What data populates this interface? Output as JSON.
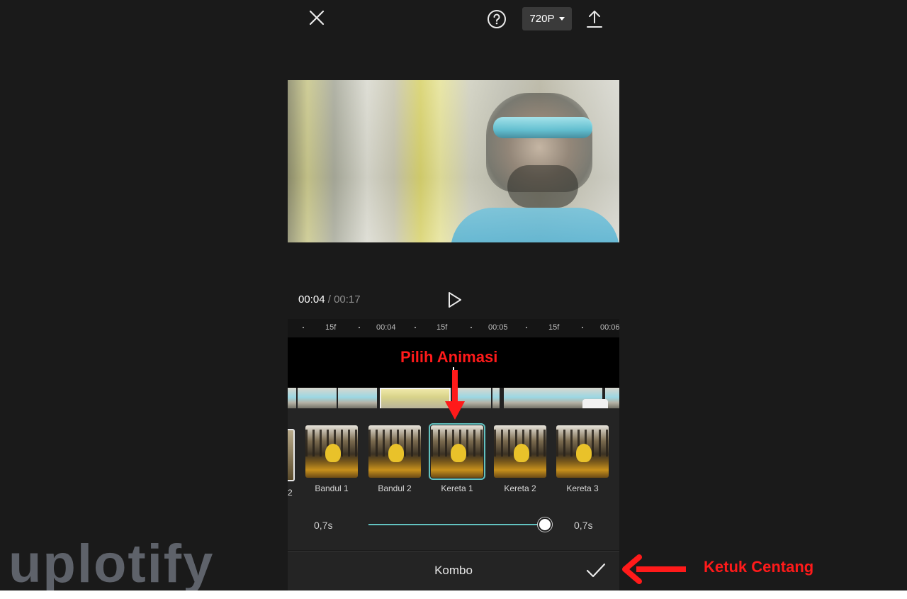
{
  "topbar": {
    "resolution": "720P",
    "icons": [
      "close-icon",
      "help-icon",
      "export-icon"
    ]
  },
  "player": {
    "current_time": "00:04",
    "separator": " / ",
    "total_time": "00:17"
  },
  "ruler": {
    "labels": [
      "15f",
      "00:04",
      "15f",
      "00:05",
      "15f",
      "00:06"
    ]
  },
  "animations": {
    "prev_label": "2",
    "items": [
      {
        "label": "Bandul 1",
        "selected": false
      },
      {
        "label": "Bandul 2",
        "selected": false
      },
      {
        "label": "Kereta 1",
        "selected": true
      },
      {
        "label": "Kereta 2",
        "selected": false
      },
      {
        "label": "Kereta 3",
        "selected": false
      }
    ]
  },
  "duration": {
    "min_label": "0,7s",
    "value_label": "0,7s",
    "slider_fraction": 1.0
  },
  "bottom": {
    "title": "Kombo"
  },
  "annotations": {
    "pick_animation": "Pilih Animasi",
    "tap_check": "Ketuk Centang"
  },
  "watermark": "uplotify",
  "colors": {
    "accent": "#62c2c0",
    "annotation": "#ff1a1a",
    "background": "#1a1a1a"
  }
}
